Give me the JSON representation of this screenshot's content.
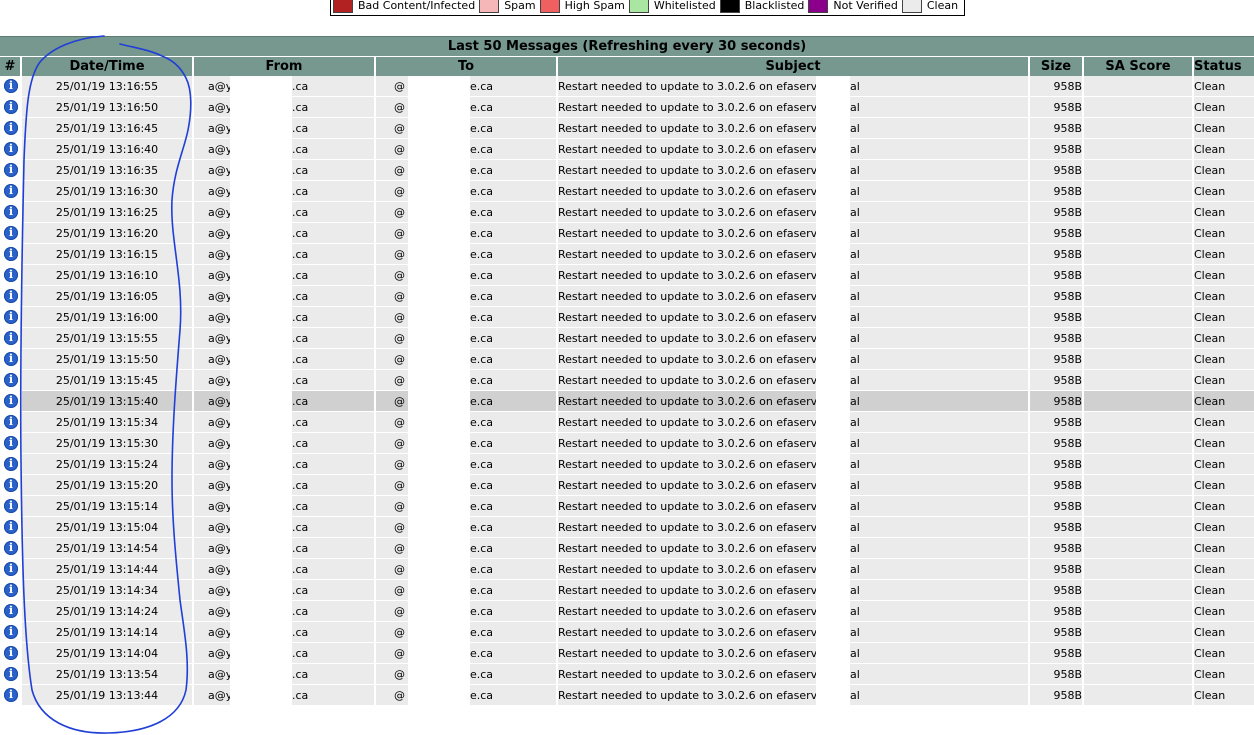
{
  "legend": [
    {
      "label": "Bad Content/Infected",
      "color": "#b22222"
    },
    {
      "label": "Spam",
      "color": "#f5b7b7"
    },
    {
      "label": "High Spam",
      "color": "#f06060"
    },
    {
      "label": "Whitelisted",
      "color": "#a8e6a1"
    },
    {
      "label": "Blacklisted",
      "color": "#000000"
    },
    {
      "label": "Not Verified",
      "color": "#8b008b"
    },
    {
      "label": "Clean",
      "color": "#ebebeb"
    }
  ],
  "table": {
    "caption": "Last 50 Messages (Refreshing every 30 seconds)",
    "headers": {
      "num": "#",
      "datetime": "Date/Time",
      "from": "From",
      "to": "To",
      "subject": "Subject",
      "size": "Size",
      "sa_score": "SA Score",
      "status": "Status"
    },
    "rows": [
      {
        "datetime": "25/01/19 13:16:55",
        "from_pre": "a@y",
        "from_post": ".ca",
        "to_pre": "@",
        "to_post": "e.ca",
        "subject_pre": "Restart needed to update to 3.0.2.6 on efaserv.",
        "subject_post": "al",
        "size": "958B",
        "sa_score": "",
        "status": "Clean"
      },
      {
        "datetime": "25/01/19 13:16:50",
        "from_pre": "a@y",
        "from_post": ".ca",
        "to_pre": "@",
        "to_post": "e.ca",
        "subject_pre": "Restart needed to update to 3.0.2.6 on efaserv.",
        "subject_post": "al",
        "size": "958B",
        "sa_score": "",
        "status": "Clean"
      },
      {
        "datetime": "25/01/19 13:16:45",
        "from_pre": "a@y",
        "from_post": ".ca",
        "to_pre": "@",
        "to_post": "e.ca",
        "subject_pre": "Restart needed to update to 3.0.2.6 on efaserv.",
        "subject_post": "al",
        "size": "958B",
        "sa_score": "",
        "status": "Clean"
      },
      {
        "datetime": "25/01/19 13:16:40",
        "from_pre": "a@y",
        "from_post": ".ca",
        "to_pre": "@",
        "to_post": "e.ca",
        "subject_pre": "Restart needed to update to 3.0.2.6 on efaserv.",
        "subject_post": "al",
        "size": "958B",
        "sa_score": "",
        "status": "Clean"
      },
      {
        "datetime": "25/01/19 13:16:35",
        "from_pre": "a@y",
        "from_post": ".ca",
        "to_pre": "@",
        "to_post": "e.ca",
        "subject_pre": "Restart needed to update to 3.0.2.6 on efaserv.",
        "subject_post": "al",
        "size": "958B",
        "sa_score": "",
        "status": "Clean"
      },
      {
        "datetime": "25/01/19 13:16:30",
        "from_pre": "a@y",
        "from_post": ".ca",
        "to_pre": "@",
        "to_post": "e.ca",
        "subject_pre": "Restart needed to update to 3.0.2.6 on efaserv.",
        "subject_post": "al",
        "size": "958B",
        "sa_score": "",
        "status": "Clean"
      },
      {
        "datetime": "25/01/19 13:16:25",
        "from_pre": "a@y",
        "from_post": ".ca",
        "to_pre": "@",
        "to_post": "e.ca",
        "subject_pre": "Restart needed to update to 3.0.2.6 on efaserv.",
        "subject_post": "al",
        "size": "958B",
        "sa_score": "",
        "status": "Clean"
      },
      {
        "datetime": "25/01/19 13:16:20",
        "from_pre": "a@y",
        "from_post": ".ca",
        "to_pre": "@",
        "to_post": "e.ca",
        "subject_pre": "Restart needed to update to 3.0.2.6 on efaserv.",
        "subject_post": "al",
        "size": "958B",
        "sa_score": "",
        "status": "Clean"
      },
      {
        "datetime": "25/01/19 13:16:15",
        "from_pre": "a@y",
        "from_post": ".ca",
        "to_pre": "@",
        "to_post": "e.ca",
        "subject_pre": "Restart needed to update to 3.0.2.6 on efaserv.",
        "subject_post": "al",
        "size": "958B",
        "sa_score": "",
        "status": "Clean"
      },
      {
        "datetime": "25/01/19 13:16:10",
        "from_pre": "a@y",
        "from_post": ".ca",
        "to_pre": "@",
        "to_post": "e.ca",
        "subject_pre": "Restart needed to update to 3.0.2.6 on efaserv.",
        "subject_post": "al",
        "size": "958B",
        "sa_score": "",
        "status": "Clean"
      },
      {
        "datetime": "25/01/19 13:16:05",
        "from_pre": "a@y",
        "from_post": ".ca",
        "to_pre": "@",
        "to_post": "e.ca",
        "subject_pre": "Restart needed to update to 3.0.2.6 on efaserv.",
        "subject_post": "al",
        "size": "958B",
        "sa_score": "",
        "status": "Clean"
      },
      {
        "datetime": "25/01/19 13:16:00",
        "from_pre": "a@y",
        "from_post": ".ca",
        "to_pre": "@",
        "to_post": "e.ca",
        "subject_pre": "Restart needed to update to 3.0.2.6 on efaserv.",
        "subject_post": "al",
        "size": "958B",
        "sa_score": "",
        "status": "Clean"
      },
      {
        "datetime": "25/01/19 13:15:55",
        "from_pre": "a@y",
        "from_post": ".ca",
        "to_pre": "@",
        "to_post": "e.ca",
        "subject_pre": "Restart needed to update to 3.0.2.6 on efaserv.",
        "subject_post": "al",
        "size": "958B",
        "sa_score": "",
        "status": "Clean"
      },
      {
        "datetime": "25/01/19 13:15:50",
        "from_pre": "a@y",
        "from_post": ".ca",
        "to_pre": "@",
        "to_post": "e.ca",
        "subject_pre": "Restart needed to update to 3.0.2.6 on efaserv.",
        "subject_post": "al",
        "size": "958B",
        "sa_score": "",
        "status": "Clean"
      },
      {
        "datetime": "25/01/19 13:15:45",
        "from_pre": "a@y",
        "from_post": ".ca",
        "to_pre": "@",
        "to_post": "e.ca",
        "subject_pre": "Restart needed to update to 3.0.2.6 on efaserv.",
        "subject_post": "al",
        "size": "958B",
        "sa_score": "",
        "status": "Clean"
      },
      {
        "datetime": "25/01/19 13:15:40",
        "from_pre": "a@y",
        "from_post": ".ca",
        "to_pre": "@",
        "to_post": "e.ca",
        "subject_pre": "Restart needed to update to 3.0.2.6 on efaserv.",
        "subject_post": "al",
        "size": "958B",
        "sa_score": "",
        "status": "Clean",
        "selected": true
      },
      {
        "datetime": "25/01/19 13:15:34",
        "from_pre": "a@y",
        "from_post": ".ca",
        "to_pre": "@",
        "to_post": "e.ca",
        "subject_pre": "Restart needed to update to 3.0.2.6 on efaserv.",
        "subject_post": "al",
        "size": "958B",
        "sa_score": "",
        "status": "Clean"
      },
      {
        "datetime": "25/01/19 13:15:30",
        "from_pre": "a@y",
        "from_post": ".ca",
        "to_pre": "@",
        "to_post": "e.ca",
        "subject_pre": "Restart needed to update to 3.0.2.6 on efaserv.",
        "subject_post": "al",
        "size": "958B",
        "sa_score": "",
        "status": "Clean"
      },
      {
        "datetime": "25/01/19 13:15:24",
        "from_pre": "a@y",
        "from_post": ".ca",
        "to_pre": "@",
        "to_post": "e.ca",
        "subject_pre": "Restart needed to update to 3.0.2.6 on efaserv.",
        "subject_post": "al",
        "size": "958B",
        "sa_score": "",
        "status": "Clean"
      },
      {
        "datetime": "25/01/19 13:15:20",
        "from_pre": "a@y",
        "from_post": ".ca",
        "to_pre": "@",
        "to_post": "e.ca",
        "subject_pre": "Restart needed to update to 3.0.2.6 on efaserv.",
        "subject_post": "al",
        "size": "958B",
        "sa_score": "",
        "status": "Clean"
      },
      {
        "datetime": "25/01/19 13:15:14",
        "from_pre": "a@y",
        "from_post": ".ca",
        "to_pre": "@",
        "to_post": "e.ca",
        "subject_pre": "Restart needed to update to 3.0.2.6 on efaserv.",
        "subject_post": "al",
        "size": "958B",
        "sa_score": "",
        "status": "Clean"
      },
      {
        "datetime": "25/01/19 13:15:04",
        "from_pre": "a@y",
        "from_post": ".ca",
        "to_pre": "@",
        "to_post": "e.ca",
        "subject_pre": "Restart needed to update to 3.0.2.6 on efaserv.",
        "subject_post": "al",
        "size": "958B",
        "sa_score": "",
        "status": "Clean"
      },
      {
        "datetime": "25/01/19 13:14:54",
        "from_pre": "a@y",
        "from_post": ".ca",
        "to_pre": "@",
        "to_post": "e.ca",
        "subject_pre": "Restart needed to update to 3.0.2.6 on efaserv.",
        "subject_post": "al",
        "size": "958B",
        "sa_score": "",
        "status": "Clean"
      },
      {
        "datetime": "25/01/19 13:14:44",
        "from_pre": "a@y",
        "from_post": ".ca",
        "to_pre": "@",
        "to_post": "e.ca",
        "subject_pre": "Restart needed to update to 3.0.2.6 on efaserv.",
        "subject_post": "al",
        "size": "958B",
        "sa_score": "",
        "status": "Clean"
      },
      {
        "datetime": "25/01/19 13:14:34",
        "from_pre": "a@y",
        "from_post": ".ca",
        "to_pre": "@",
        "to_post": "e.ca",
        "subject_pre": "Restart needed to update to 3.0.2.6 on efaserv.",
        "subject_post": "al",
        "size": "958B",
        "sa_score": "",
        "status": "Clean"
      },
      {
        "datetime": "25/01/19 13:14:24",
        "from_pre": "a@y",
        "from_post": ".ca",
        "to_pre": "@",
        "to_post": "e.ca",
        "subject_pre": "Restart needed to update to 3.0.2.6 on efaserv.",
        "subject_post": "al",
        "size": "958B",
        "sa_score": "",
        "status": "Clean"
      },
      {
        "datetime": "25/01/19 13:14:14",
        "from_pre": "a@y",
        "from_post": ".ca",
        "to_pre": "@",
        "to_post": "e.ca",
        "subject_pre": "Restart needed to update to 3.0.2.6 on efaserv.",
        "subject_post": "al",
        "size": "958B",
        "sa_score": "",
        "status": "Clean"
      },
      {
        "datetime": "25/01/19 13:14:04",
        "from_pre": "a@y",
        "from_post": ".ca",
        "to_pre": "@",
        "to_post": "e.ca",
        "subject_pre": "Restart needed to update to 3.0.2.6 on efaserv.",
        "subject_post": "al",
        "size": "958B",
        "sa_score": "",
        "status": "Clean"
      },
      {
        "datetime": "25/01/19 13:13:54",
        "from_pre": "a@y",
        "from_post": ".ca",
        "to_pre": "@",
        "to_post": "e.ca",
        "subject_pre": "Restart needed to update to 3.0.2.6 on efaserv.",
        "subject_post": "al",
        "size": "958B",
        "sa_score": "",
        "status": "Clean"
      },
      {
        "datetime": "25/01/19 13:13:44",
        "from_pre": "a@y",
        "from_post": ".ca",
        "to_pre": "@",
        "to_post": "e.ca",
        "subject_pre": "Restart needed to update to 3.0.2.6 on efaserv.",
        "subject_post": "al",
        "size": "958B",
        "sa_score": "",
        "status": "Clean"
      }
    ]
  },
  "icons": {
    "info": "info-icon"
  },
  "annotation": {
    "color": "#1f3fd6"
  }
}
